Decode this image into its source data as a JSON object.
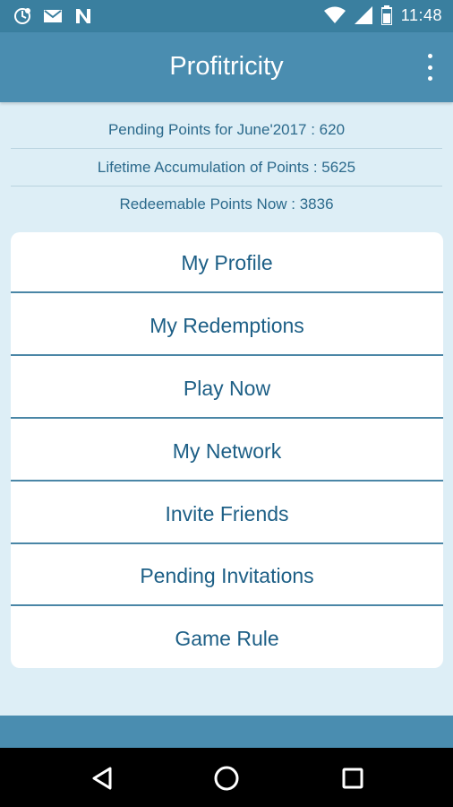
{
  "status_bar": {
    "time": "11:48",
    "icons_left": [
      "sync-notification-icon",
      "gmail-icon",
      "n-app-icon"
    ],
    "icons_right": [
      "wifi-icon",
      "signal-icon",
      "battery-icon"
    ]
  },
  "app_bar": {
    "title": "Profitricity",
    "menu_icon": "overflow-menu-icon"
  },
  "points": {
    "pending": "Pending Points for June'2017 : 620",
    "lifetime": "Lifetime Accumulation of Points : 5625",
    "redeemable": "Redeemable Points Now : 3836"
  },
  "menu": {
    "items": [
      {
        "label": "My Profile"
      },
      {
        "label": "My Redemptions"
      },
      {
        "label": "Play Now"
      },
      {
        "label": "My Network"
      },
      {
        "label": "Invite Friends"
      },
      {
        "label": "Pending Invitations"
      },
      {
        "label": "Game Rule"
      }
    ]
  },
  "colors": {
    "status_bar": "#3a7f9f",
    "app_bar": "#4a8db0",
    "background": "#ddeef6",
    "menu_text": "#1d5f86",
    "divider": "#4a86a6"
  },
  "nav_bar": {
    "back_icon": "back-triangle-icon",
    "home_icon": "home-circle-icon",
    "recents_icon": "recents-square-icon"
  }
}
